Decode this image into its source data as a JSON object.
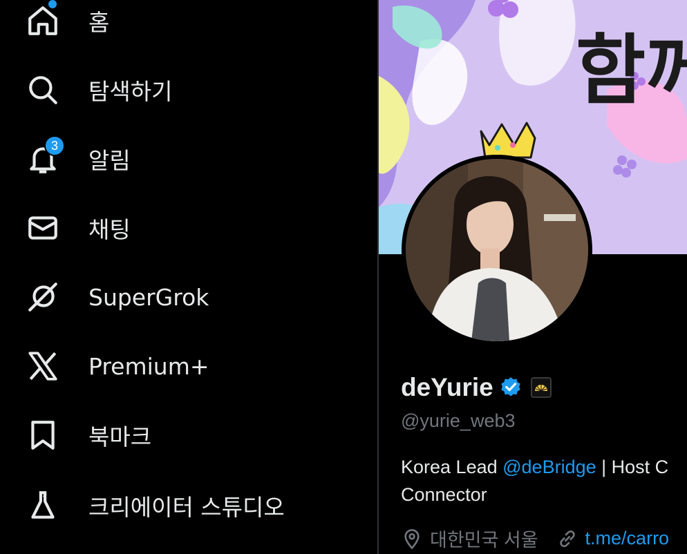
{
  "sidebar": {
    "items": [
      {
        "label": "홈",
        "icon": "home-icon"
      },
      {
        "label": "탐색하기",
        "icon": "search-icon"
      },
      {
        "label": "알림",
        "icon": "bell-icon",
        "badge": "3"
      },
      {
        "label": "채팅",
        "icon": "mail-icon"
      },
      {
        "label": "SuperGrok",
        "icon": "grok-icon"
      },
      {
        "label": "Premium+",
        "icon": "x-logo-icon"
      },
      {
        "label": "북마크",
        "icon": "bookmark-icon"
      },
      {
        "label": "크리에이터 스튜디오",
        "icon": "flask-icon"
      }
    ]
  },
  "profile": {
    "banner_text": "함께 W",
    "display_name": "deYurie",
    "handle": "@yurie_web3",
    "bio_prefix": "Korea Lead ",
    "bio_mention": "@deBridge",
    "bio_suffix": " | Host C",
    "bio_line2": "Connector",
    "location": "대한민국 서울",
    "link": "t.me/carro"
  },
  "colors": {
    "accent": "#1d9bf0",
    "text": "#e7e9ea",
    "muted": "#71767b",
    "background": "#000000"
  }
}
